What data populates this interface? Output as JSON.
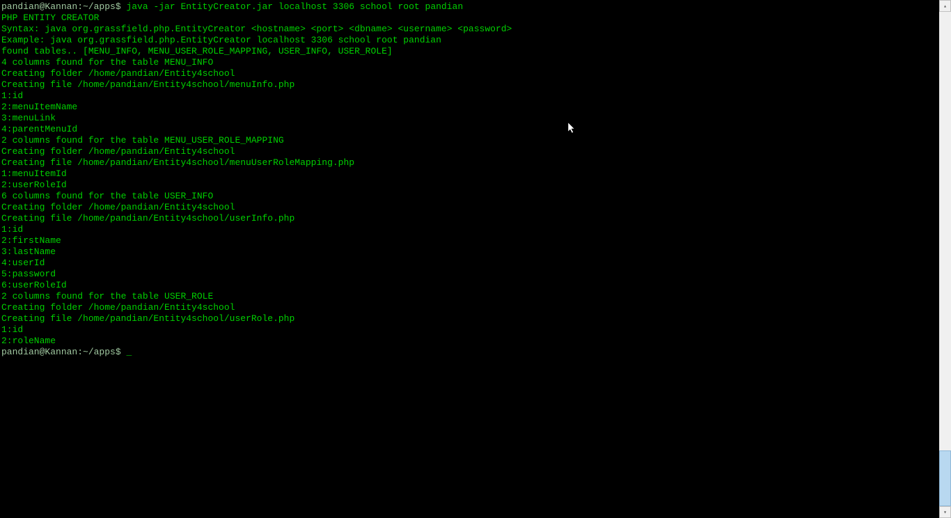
{
  "terminal": {
    "lines": [
      {
        "type": "prompt-cmd",
        "prompt": "pandian@Kannan:~/apps$",
        "cmd": " java -jar EntityCreator.jar localhost 3306 school root pandian"
      },
      {
        "type": "output",
        "text": "PHP ENTITY CREATOR"
      },
      {
        "type": "output",
        "text": "Syntax: java org.grassfield.php.EntityCreator <hostname> <port> <dbname> <username> <password>"
      },
      {
        "type": "output",
        "text": "Example: java org.grassfield.php.EntityCreator localhost 3306 school root pandian"
      },
      {
        "type": "output",
        "text": "found tables.. [MENU_INFO, MENU_USER_ROLE_MAPPING, USER_INFO, USER_ROLE]"
      },
      {
        "type": "output",
        "text": "4 columns found for the table MENU_INFO"
      },
      {
        "type": "output",
        "text": "Creating folder /home/pandian/Entity4school"
      },
      {
        "type": "output",
        "text": "Creating file /home/pandian/Entity4school/menuInfo.php"
      },
      {
        "type": "output",
        "text": "1:id"
      },
      {
        "type": "output",
        "text": "2:menuItemName"
      },
      {
        "type": "output",
        "text": "3:menuLink"
      },
      {
        "type": "output",
        "text": "4:parentMenuId"
      },
      {
        "type": "output",
        "text": "2 columns found for the table MENU_USER_ROLE_MAPPING"
      },
      {
        "type": "output",
        "text": "Creating folder /home/pandian/Entity4school"
      },
      {
        "type": "output",
        "text": "Creating file /home/pandian/Entity4school/menuUserRoleMapping.php"
      },
      {
        "type": "output",
        "text": "1:menuItemId"
      },
      {
        "type": "output",
        "text": "2:userRoleId"
      },
      {
        "type": "output",
        "text": "6 columns found for the table USER_INFO"
      },
      {
        "type": "output",
        "text": "Creating folder /home/pandian/Entity4school"
      },
      {
        "type": "output",
        "text": "Creating file /home/pandian/Entity4school/userInfo.php"
      },
      {
        "type": "output",
        "text": "1:id"
      },
      {
        "type": "output",
        "text": "2:firstName"
      },
      {
        "type": "output",
        "text": "3:lastName"
      },
      {
        "type": "output",
        "text": "4:userId"
      },
      {
        "type": "output",
        "text": "5:password"
      },
      {
        "type": "output",
        "text": "6:userRoleId"
      },
      {
        "type": "output",
        "text": "2 columns found for the table USER_ROLE"
      },
      {
        "type": "output",
        "text": "Creating folder /home/pandian/Entity4school"
      },
      {
        "type": "output",
        "text": "Creating file /home/pandian/Entity4school/userRole.php"
      },
      {
        "type": "output",
        "text": "1:id"
      },
      {
        "type": "output",
        "text": "2:roleName"
      },
      {
        "type": "prompt-only",
        "prompt": "pandian@Kannan:~/apps$",
        "cursor": "_"
      }
    ]
  },
  "scrollbar": {
    "up_glyph": "▴",
    "down_glyph": "▾"
  }
}
